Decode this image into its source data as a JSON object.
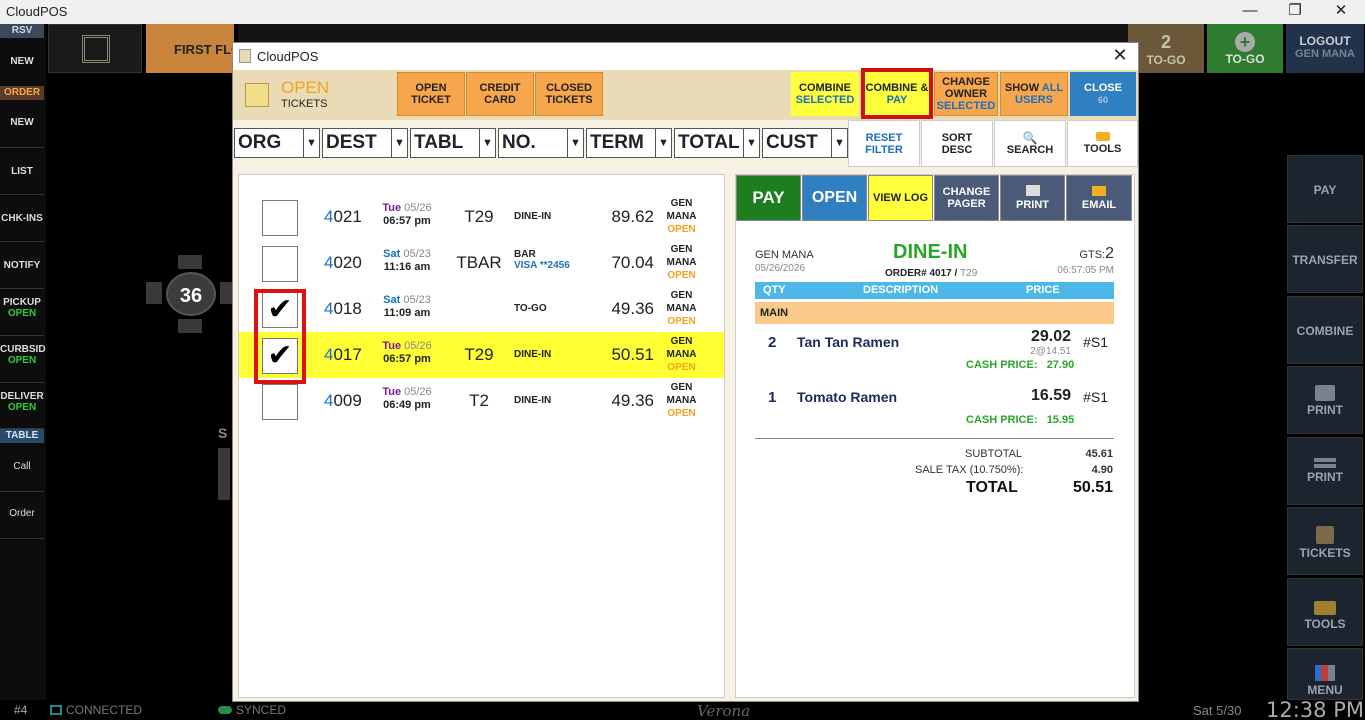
{
  "app_title": "CloudPOS",
  "window_controls": {
    "minimize": "—",
    "restore": "❐",
    "close": "✕"
  },
  "left_rail": {
    "rsv_label": "RSV",
    "rsv_new": "NEW",
    "order_label": "ORDER",
    "order_new": "NEW",
    "list": "LIST",
    "chk_ins": "CHK-INS",
    "notify": "NOTIFY",
    "pickup": "PICKUP",
    "pickup_status": "OPEN",
    "curbside": "CURBSID",
    "curbside_status": "OPEN",
    "delivery": "DELIVER",
    "delivery_status": "OPEN",
    "table_label": "TABLE",
    "call": "Call",
    "order": "Order"
  },
  "top_bar": {
    "floor_label": "FIRST FLO",
    "togo_count": "2",
    "togo_label": "TO-GO",
    "togo_add_label": "TO-GO",
    "logout_label": "LOGOUT",
    "logout_user": "GEN MANA"
  },
  "right_column": {
    "pay": "PAY",
    "transfer": "TRANSFER",
    "combine": "COMBINE",
    "print1": "PRINT",
    "print2": "PRINT",
    "tickets": "TICKETS",
    "tools": "TOOLS",
    "menu": "MENU"
  },
  "floor": {
    "table_number": "36",
    "partial_label": "S"
  },
  "status_bar": {
    "station": "#4",
    "connected": "CONNECTED",
    "synced": "SYNCED",
    "venue": "Verona",
    "date": "Sat 5/30",
    "time": "12:38 PM"
  },
  "dialog": {
    "title": "CloudPOS",
    "close": "✕",
    "status_label": "OPEN",
    "status_sub": "TICKETS",
    "buttons": {
      "open_ticket": [
        "OPEN",
        "TICKET"
      ],
      "credit_card": [
        "CREDIT",
        "CARD"
      ],
      "closed_tickets": [
        "CLOSED",
        "TICKETS"
      ],
      "combine_selected": [
        "COMBINE",
        "SELECTED"
      ],
      "combine_pay": [
        "COMBINE &",
        "PAY"
      ],
      "change_owner": [
        "CHANGE",
        "OWNER",
        "SELECTED"
      ],
      "show_all_users": [
        "SHOW",
        "ALL",
        "USERS"
      ],
      "close": [
        "CLOSE",
        "60"
      ]
    },
    "filters": {
      "org": "ORG",
      "dest": "DEST",
      "tabl": "TABL",
      "no": "NO.",
      "term": "TERM",
      "total": "TOTAL",
      "cust": "CUST",
      "reset_filter": [
        "RESET",
        "FILTER"
      ],
      "sort_desc": [
        "SORT",
        "DESC"
      ],
      "search": "SEARCH",
      "tools": "TOOLS"
    },
    "tickets": [
      {
        "first_digit": "4",
        "rest": "021",
        "day": "Tue",
        "date": "05/26",
        "time": "06:57 pm",
        "table": "T29",
        "dest": "DINE-IN",
        "visa": "",
        "total": "89.62",
        "owner1": "GEN",
        "owner2": "MANA",
        "status": "OPEN",
        "checked": false,
        "selected": false
      },
      {
        "first_digit": "4",
        "rest": "020",
        "day": "Sat",
        "date": "05/23",
        "time": "11:16 am",
        "table": "TBAR",
        "dest": "BAR",
        "visa": "VISA **2456",
        "total": "70.04",
        "owner1": "GEN",
        "owner2": "MANA",
        "status": "OPEN",
        "checked": false,
        "selected": false
      },
      {
        "first_digit": "4",
        "rest": "018",
        "day": "Sat",
        "date": "05/23",
        "time": "11:09 am",
        "table": "",
        "dest": "TO-GO",
        "visa": "",
        "total": "49.36",
        "owner1": "GEN",
        "owner2": "MANA",
        "status": "OPEN",
        "checked": true,
        "selected": false
      },
      {
        "first_digit": "4",
        "rest": "017",
        "day": "Tue",
        "date": "05/26",
        "time": "06:57 pm",
        "table": "T29",
        "dest": "DINE-IN",
        "visa": "",
        "total": "50.51",
        "owner1": "GEN",
        "owner2": "MANA",
        "status": "OPEN",
        "checked": true,
        "selected": true
      },
      {
        "first_digit": "4",
        "rest": "009",
        "day": "Tue",
        "date": "05/26",
        "time": "06:49 pm",
        "table": "T2",
        "dest": "DINE-IN",
        "visa": "",
        "total": "49.36",
        "owner1": "GEN",
        "owner2": "MANA",
        "status": "OPEN",
        "checked": false,
        "selected": false
      }
    ],
    "detail": {
      "pay": "PAY",
      "open": "OPEN",
      "view_log": "VIEW LOG",
      "change_pager": [
        "CHANGE",
        "PAGER"
      ],
      "print": "PRINT",
      "email": "EMAIL",
      "server": "GEN MANA",
      "order_date": "05/26/2026",
      "order_type": "DINE-IN",
      "order_no_label": "ORDER# 4017 /",
      "order_table": "T29",
      "gts_label": "GTS:",
      "gts_value": "2",
      "order_time": "06:57:05 PM",
      "col_qty": "QTY",
      "col_desc": "DESCRIPTION",
      "col_price": "PRICE",
      "section": "MAIN",
      "items": [
        {
          "qty": "2",
          "name": "Tan Tan Ramen",
          "price": "29.02",
          "unit": "2@14.51",
          "seat": "#S1",
          "cash_label": "CASH PRICE:",
          "cash_price": "27.90"
        },
        {
          "qty": "1",
          "name": "Tomato Ramen",
          "price": "16.59",
          "unit": "",
          "seat": "#S1",
          "cash_label": "CASH PRICE:",
          "cash_price": "15.95"
        }
      ],
      "subtotal_label": "SUBTOTAL",
      "subtotal": "45.61",
      "tax_label": "SALE TAX (10.750%):",
      "tax": "4.90",
      "total_label": "TOTAL",
      "total": "50.51"
    }
  },
  "colors": {
    "accent_orange": "#f7a64c",
    "combine_yellow": "#ffff3c",
    "close_blue": "#2f7fc1",
    "pay_green": "#1e7d1e",
    "open_blue": "#2f7fc1",
    "highlight_red": "#d11111",
    "selected_row": "#ffff33"
  }
}
